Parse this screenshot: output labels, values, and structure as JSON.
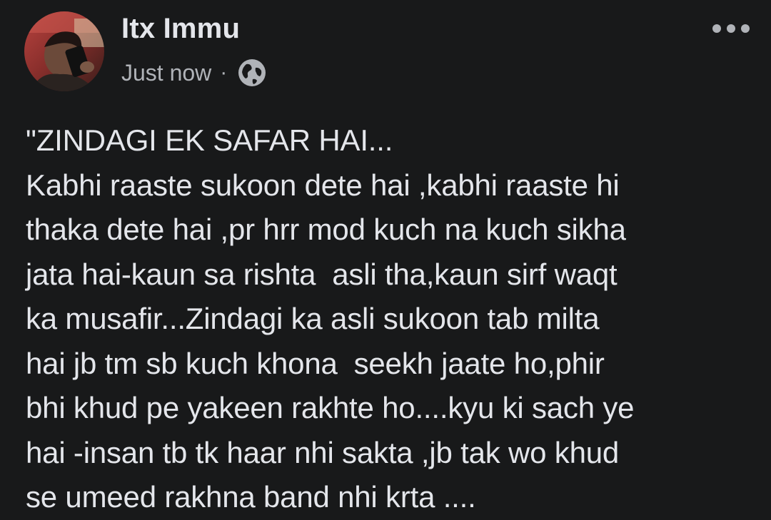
{
  "post": {
    "author_name": "Itx Immu",
    "timestamp": "Just now",
    "separator": "·",
    "privacy_icon": "globe-icon",
    "more_icon": "more-options-icon",
    "text_lines": [
      "\"ZINDAGI EK SAFAR HAI...",
      "Kabhi raaste sukoon dete hai ,kabhi raaste hi",
      "thaka dete hai ,pr hrr mod kuch na kuch sikha",
      "jata hai-kaun sa rishta  asli tha,kaun sirf waqt",
      "ka musafir...Zindagi ka asli sukoon tab milta",
      "hai jb tm sb kuch khona  seekh jaate ho,phir",
      "bhi khud pe yakeen rakhte ho....kyu ki sach ye",
      "hai -insan tb tk haar nhi sakta ,jb tak wo khud",
      "se umeed rakhna band nhi krta ...."
    ]
  },
  "colors": {
    "background": "#18191a",
    "primary_text": "#e4e6eb",
    "secondary_text": "#b0b3b8"
  }
}
